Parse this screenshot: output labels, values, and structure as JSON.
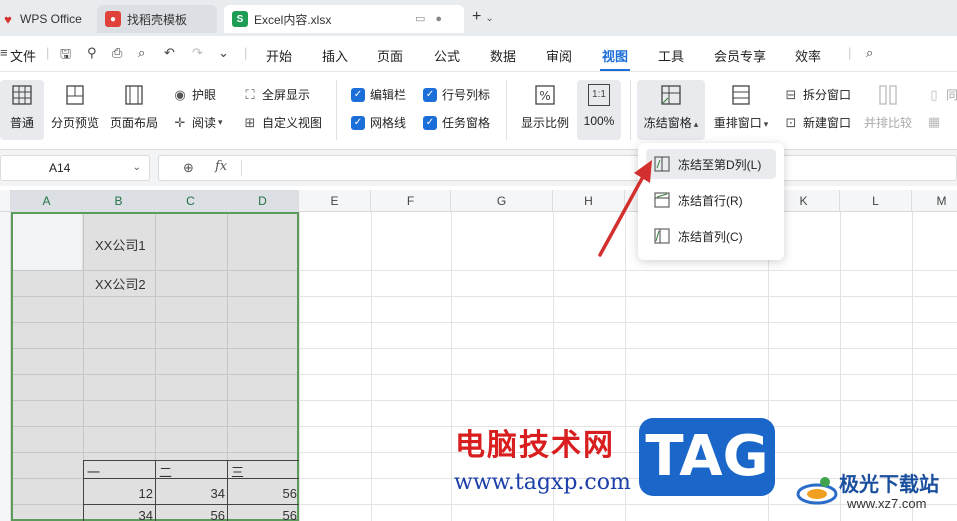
{
  "tabs": {
    "wps": "WPS Office",
    "template": "找稻壳模板",
    "excel": "Excel内容.xlsx"
  },
  "menu": {
    "file": "文件",
    "items": [
      "开始",
      "插入",
      "页面",
      "公式",
      "数据",
      "审阅",
      "视图",
      "工具",
      "会员专享",
      "效率"
    ],
    "active": "视图"
  },
  "ribbon": {
    "normal": "普通",
    "page_break": "分页预览",
    "page_layout": "页面布局",
    "eye_care": "护眼",
    "reading": "阅读",
    "full_screen": "全屏显示",
    "custom_view": "自定义视图",
    "edit_bar": "编辑栏",
    "grid_lines": "网格线",
    "row_col_header": "行号列标",
    "task_pane": "任务窗格",
    "zoom_ratio": "显示比例",
    "zoom_100": "100%",
    "zoom_icon_text": "1:1",
    "freeze": "冻结窗格",
    "arrange": "重排窗口",
    "split": "拆分窗口",
    "new_window": "新建窗口",
    "side_by_side": "并排比较",
    "trailing": "同"
  },
  "formula_bar": {
    "cell_ref": "A14",
    "fx": "fx"
  },
  "columns": [
    "A",
    "B",
    "C",
    "D",
    "E",
    "F",
    "G",
    "H",
    "",
    "K",
    "L",
    "M"
  ],
  "cells": {
    "b1": "XX公司1",
    "b2": "XX公司2",
    "header_b": "一",
    "header_c": "二",
    "header_d": "三",
    "row1": [
      "12",
      "34",
      "56"
    ],
    "row2": [
      "34",
      "56",
      "56"
    ]
  },
  "freeze_menu": {
    "items": [
      "冻结至第D列(L)",
      "冻结首行(R)",
      "冻结首列(C)"
    ]
  },
  "watermark": {
    "site_cn": "电脑技术网",
    "site_url": "www.tagxp.com",
    "tag": "TAG",
    "logo_cn": "极光下载站",
    "logo_url": "www.xz7.com"
  },
  "colors": {
    "accent": "#1c6fd9",
    "selection_border": "#5b9b5b",
    "arrow": "#d32f2f",
    "tag_bg": "#1a67c9"
  }
}
